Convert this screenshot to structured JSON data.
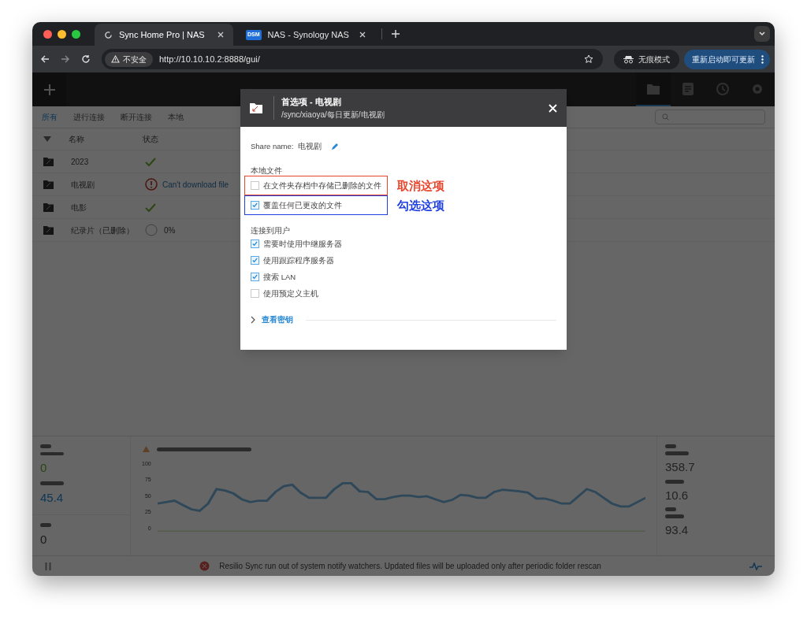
{
  "browser": {
    "tabs": [
      {
        "title": "Sync Home Pro | NAS",
        "selected": true,
        "kind": "spinner"
      },
      {
        "title": "NAS - Synology NAS",
        "selected": false,
        "kind": "dsm",
        "badge": "DSM"
      }
    ],
    "security": "不安全",
    "url": "http://10.10.10.2:8888/gui/",
    "incognito": "无痕模式",
    "update_button": "重新启动即可更新"
  },
  "app": {
    "nav": [
      {
        "kind": "folder",
        "selected": true
      },
      {
        "kind": "note",
        "selected": false
      },
      {
        "kind": "clock",
        "selected": false
      },
      {
        "kind": "gear",
        "selected": false
      }
    ],
    "filters": [
      {
        "label": "所有",
        "selected": true
      },
      {
        "label": "进行连接",
        "selected": false
      },
      {
        "label": "断开连接",
        "selected": false
      },
      {
        "label": "本地",
        "selected": false
      }
    ],
    "columns": [
      "名称",
      "状态"
    ],
    "rows": [
      {
        "name": "2023",
        "kind": "ok"
      },
      {
        "name": "电视剧",
        "kind": "error",
        "message": "Can't download file"
      },
      {
        "name": "电影",
        "kind": "ok"
      },
      {
        "name": "纪录片（已删除）",
        "kind": "progress",
        "message": "0%"
      }
    ],
    "upload": "0",
    "download": "45.4",
    "disk": "0",
    "chart_data": {
      "type": "line",
      "ylim": [
        0,
        100
      ],
      "yticks": [
        0,
        25,
        50,
        75,
        100
      ],
      "series": [
        {
          "color": "#2e4859",
          "values": [
            40,
            42,
            44,
            38,
            32,
            30,
            40,
            60,
            58,
            54,
            46,
            42,
            44,
            44,
            56,
            64,
            66,
            55,
            48,
            48,
            48,
            60,
            68,
            68,
            57,
            56,
            46,
            46,
            49,
            51,
            51,
            49,
            50,
            46,
            42,
            45,
            52,
            51,
            48,
            48,
            56,
            59,
            58,
            57,
            55,
            47,
            47,
            44,
            40,
            40,
            50,
            60,
            56,
            48,
            40,
            36,
            36,
            42,
            48
          ]
        }
      ]
    },
    "peak": "358.7",
    "transferred": "10.6",
    "history": "93.4",
    "status_message": "Resilio Sync run out of system notify watchers. Updated files will be uploaded only after periodic folder rescan"
  },
  "dialog": {
    "title": "首选项 - 电视剧",
    "path": "/sync/xiaoya/每日更新/电视剧",
    "share_label": "Share name:",
    "share_value": "电视剧",
    "sections": [
      {
        "heading": "本地文件",
        "options": [
          {
            "label": "在文件夹存档中存储已删除的文件",
            "checked": false,
            "annotation": {
              "text": "取消这项",
              "color": "#e8452c"
            }
          },
          {
            "label": "覆盖任何已更改的文件",
            "checked": true,
            "annotation": {
              "text": "勾选这项",
              "color": "#1f3fe0"
            }
          }
        ]
      },
      {
        "heading": "连接到用户",
        "options": [
          {
            "label": "需要时使用中继服务器",
            "checked": true
          },
          {
            "label": "使用跟踪程序服务器",
            "checked": true
          },
          {
            "label": "搜索 LAN",
            "checked": true
          },
          {
            "label": "使用预定义主机",
            "checked": false
          }
        ]
      }
    ],
    "keys_link": "查看密钥"
  }
}
